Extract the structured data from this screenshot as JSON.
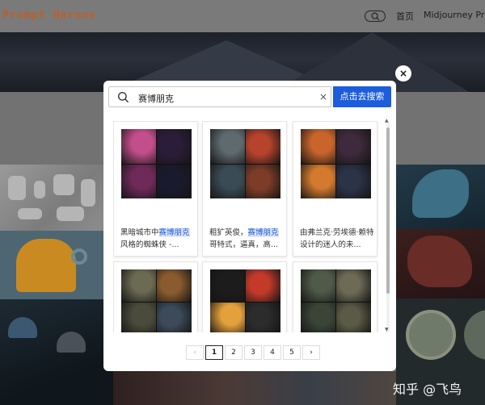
{
  "header": {
    "logo": "Prompt Heroes",
    "nav": {
      "home": "首页",
      "midjourney": "Midjourney Promp"
    }
  },
  "modal": {
    "close_label": "×",
    "search": {
      "value": "赛博朋克",
      "clear": "×",
      "button": "点击去搜索"
    },
    "results": [
      {
        "pre": "黑暗城市中",
        "hl": "赛博朋克",
        "post": "风格的蜘蛛侠 -...",
        "palette": [
          "#c24e8b",
          "#2b1d3a",
          "#6f2a5a",
          "#1a1a2e"
        ]
      },
      {
        "pre": "粗犷英俊，",
        "hl": "赛博朋克",
        "post": "哥特式，逼真，高...",
        "palette": [
          "#5f6a6f",
          "#b8432c",
          "#3b4b56",
          "#7d3c28"
        ]
      },
      {
        "pre": "由弗兰克·劳埃德·赖特设计的迷人的未...",
        "hl": "",
        "post": "",
        "palette": [
          "#c9652b",
          "#3e2a3c",
          "#d47a2e",
          "#2b3347"
        ]
      },
      {
        "pre": "",
        "hl": "",
        "post": "",
        "palette": [
          "#6b6a52",
          "#8a5b2f",
          "#4b4b3c",
          "#3c4a5a"
        ]
      },
      {
        "pre": "",
        "hl": "",
        "post": "",
        "palette": [
          "#1c1c1c",
          "#c43a2a",
          "#e4a13b",
          "#2c2c2c"
        ]
      },
      {
        "pre": "",
        "hl": "",
        "post": "",
        "palette": [
          "#4f5a48",
          "#6d6b55",
          "#3a4538",
          "#5a5a46"
        ]
      }
    ],
    "pagination": {
      "prev": "‹",
      "pages": [
        "1",
        "2",
        "3",
        "4",
        "5"
      ],
      "active": "1",
      "next": "›"
    }
  },
  "watermark": "知乎 @飞鸟"
}
